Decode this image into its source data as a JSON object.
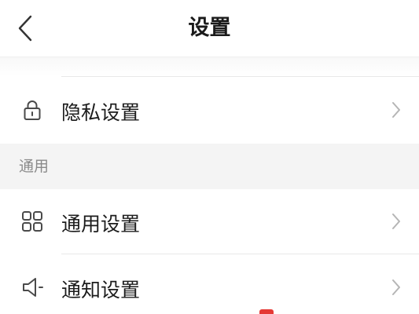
{
  "header": {
    "back_icon": "chevron-left-icon",
    "title": "设置"
  },
  "rows": [
    {
      "label": "隐私设置",
      "icon": "lock-icon"
    },
    {
      "label": "通用设置",
      "icon": "grid-icon"
    },
    {
      "label": "通知设置",
      "icon": "speaker-icon"
    }
  ],
  "section": {
    "label": "通用"
  },
  "colors": {
    "background": "#ffffff",
    "section_background": "#f4f4f4",
    "section_text": "#8a8a8a",
    "icon_stroke": "#4a4a4a",
    "chevron": "#b5b5b5",
    "accent": "#e53935"
  }
}
